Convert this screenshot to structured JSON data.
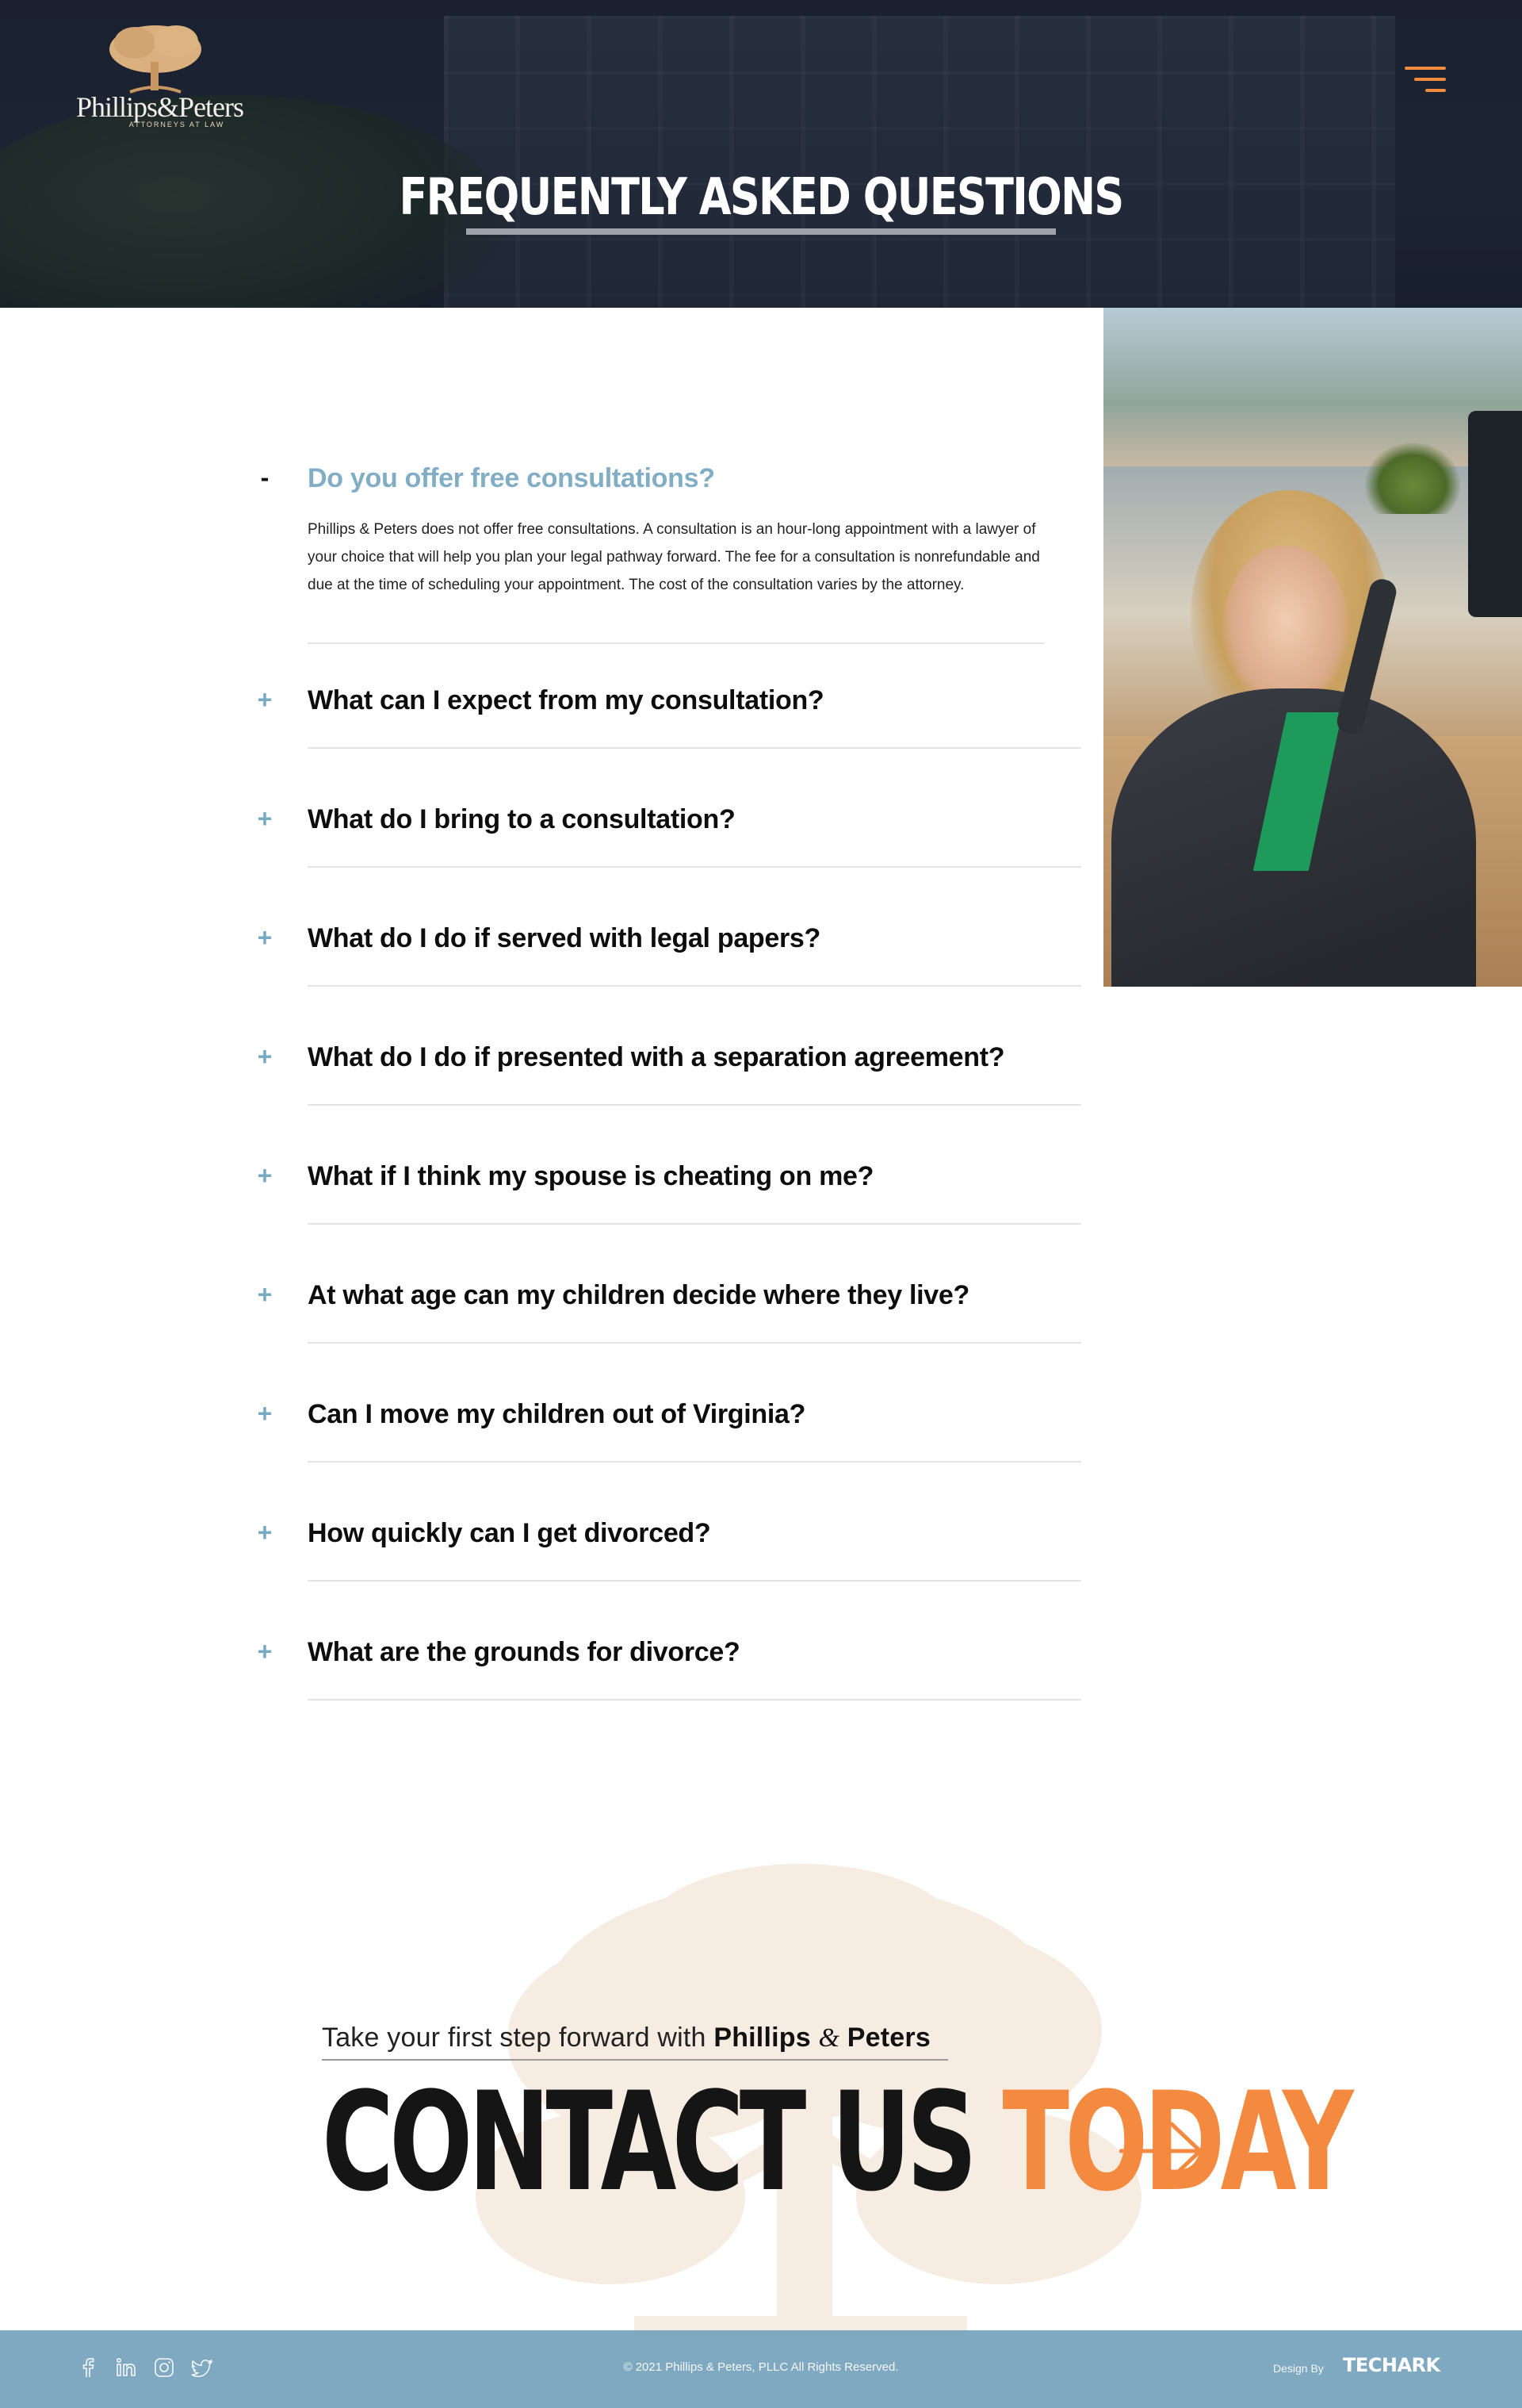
{
  "header": {
    "logo": {
      "name": "Phillips&Peters",
      "subtitle": "ATTORNEYS AT LAW"
    },
    "menu_icon": "hamburger-menu-icon",
    "title": "FREQUENTLY ASKED QUESTIONS"
  },
  "faq": {
    "items": [
      {
        "question": "Do you offer free consultations?",
        "expanded": true,
        "toggle": "-",
        "answer": "Phillips & Peters does not offer free consultations. A consultation is an hour-long appointment with a lawyer of your choice that will help you plan your legal pathway forward. The fee for a consultation is nonrefundable and due at the time of scheduling your appointment. The cost of the consultation varies by the attorney."
      },
      {
        "question": "What can I expect from my consultation?",
        "expanded": false,
        "toggle": "+"
      },
      {
        "question": "What do I bring to a consultation?",
        "expanded": false,
        "toggle": "+"
      },
      {
        "question": "What do I do if served with legal papers?",
        "expanded": false,
        "toggle": "+"
      },
      {
        "question": "What do I do if presented with a separation agreement?",
        "expanded": false,
        "toggle": "+"
      },
      {
        "question": "What if I think my spouse is cheating on me?",
        "expanded": false,
        "toggle": "+"
      },
      {
        "question": "At what age can my children decide where they live?",
        "expanded": false,
        "toggle": "+"
      },
      {
        "question": "Can I move my children out of Virginia?",
        "expanded": false,
        "toggle": "+"
      },
      {
        "question": "How quickly can I get divorced?",
        "expanded": false,
        "toggle": "+"
      },
      {
        "question": "What are the grounds for divorce?",
        "expanded": false,
        "toggle": "+"
      }
    ]
  },
  "cta": {
    "tagline_prefix": "Take your first step forward with ",
    "brand_first": "Phillips",
    "brand_amp": "&",
    "brand_last": "Peters",
    "heading_dark": "CONTACT US ",
    "heading_orange": "TODAY",
    "arrow_icon": "arrow-right-icon"
  },
  "footer": {
    "social_icons": [
      "facebook-icon",
      "linkedin-icon",
      "instagram-icon",
      "twitter-icon"
    ],
    "copyright": "© 2021  Phillips & Peters, PLLC  All Rights Reserved.",
    "design_by": "Design By",
    "designer": "TECHARK"
  },
  "colors": {
    "accent_orange": "#f38a3f",
    "accent_blue": "#82aec5",
    "footer_blue": "#7fa9c0",
    "hero_dark": "#1f2636"
  }
}
